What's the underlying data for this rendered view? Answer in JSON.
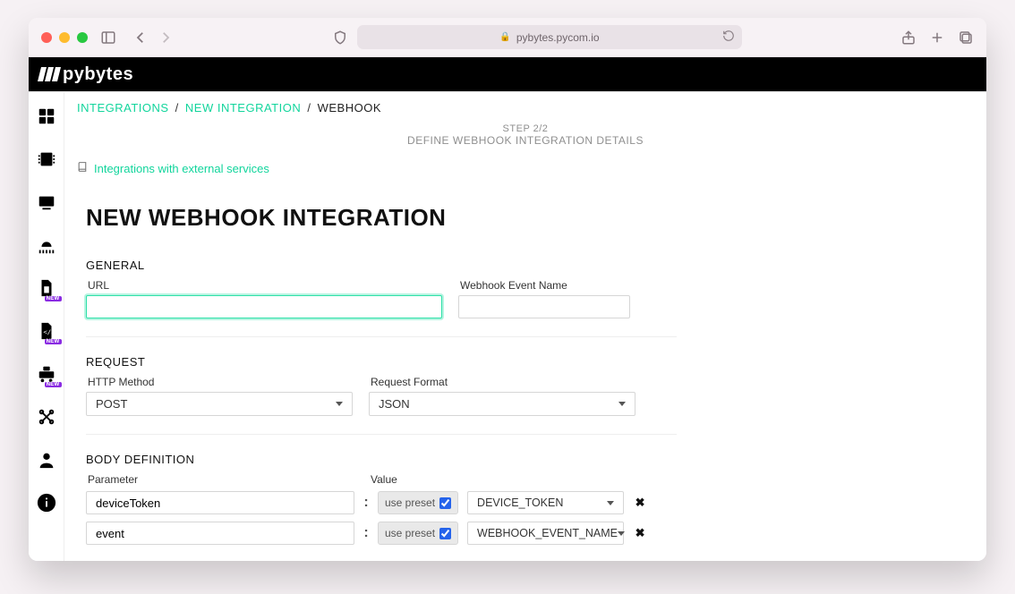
{
  "browser": {
    "url_host": "pybytes.pycom.io"
  },
  "logo_text": "pybytes",
  "breadcrumb": {
    "a": "Integrations",
    "b": "New Integration",
    "c": "Webhook"
  },
  "step": {
    "line1": "Step 2/2",
    "line2": "Define Webhook Integration Details"
  },
  "help": {
    "label": "Integrations with external services"
  },
  "form": {
    "title": "New Webhook Integration",
    "general": {
      "heading": "General",
      "url_label": "URL",
      "url_value": "",
      "event_label": "Webhook Event Name",
      "event_value": ""
    },
    "request": {
      "heading": "Request",
      "method_label": "HTTP Method",
      "method_value": "POST",
      "format_label": "Request Format",
      "format_value": "JSON"
    },
    "body": {
      "heading": "Body Definition",
      "col_param": "Parameter",
      "col_value": "Value",
      "preset_label": "use preset",
      "rows": [
        {
          "param": "deviceToken",
          "preset": true,
          "value": "DEVICE_TOKEN"
        },
        {
          "param": "event",
          "preset": true,
          "value": "WEBHOOK_EVENT_NAME"
        }
      ]
    }
  }
}
